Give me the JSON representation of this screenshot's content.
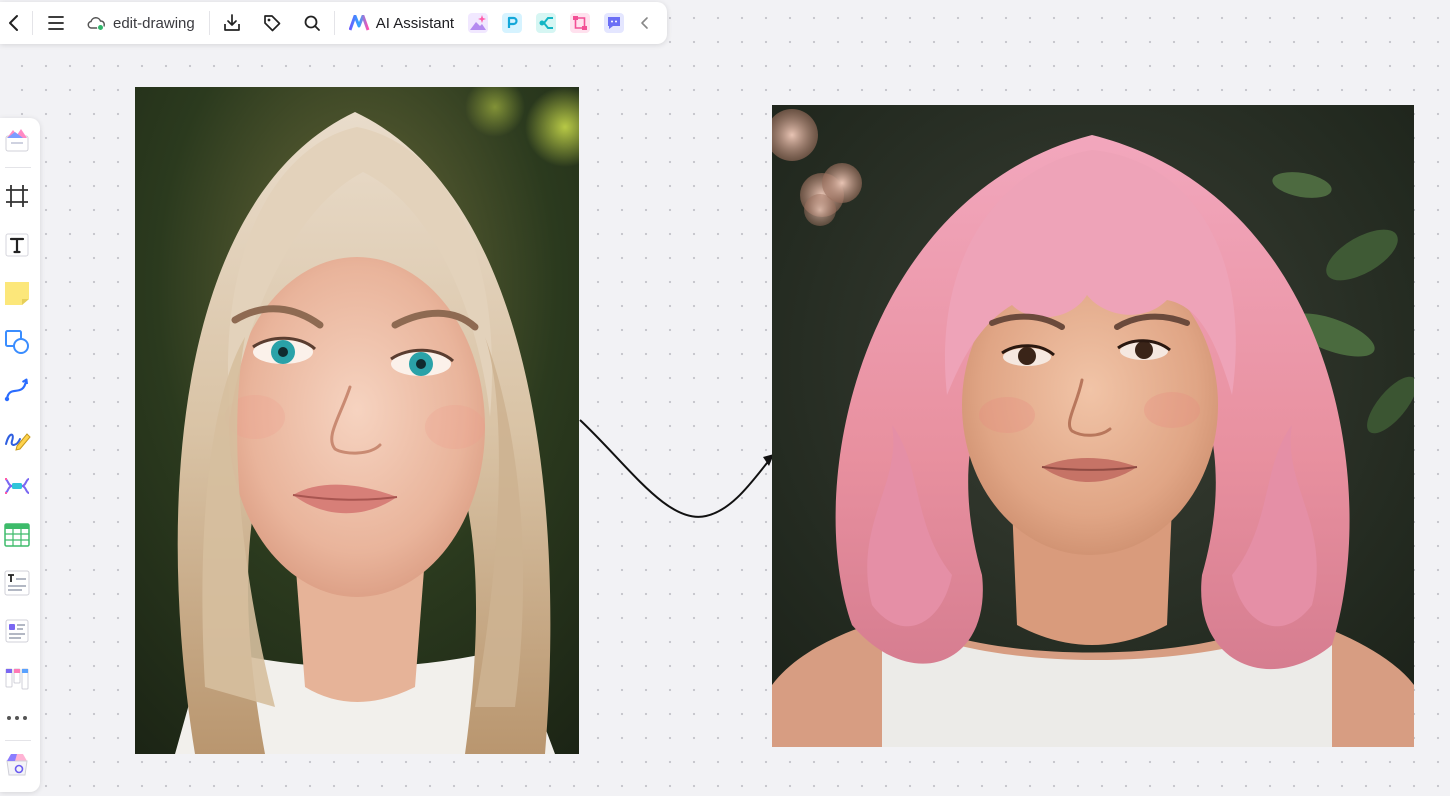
{
  "toolbar": {
    "doc_title": "edit-drawing",
    "ai_assistant_label": "AI Assistant",
    "icons": [
      "back-icon",
      "menu-icon",
      "cloud-sync-icon",
      "download-icon",
      "tag-icon",
      "search-icon",
      "ai-logo-icon",
      "image-generate-icon",
      "presentation-app-icon",
      "mindmap-app-icon",
      "flowchart-app-icon",
      "chat-app-icon",
      "collapse-chevron-icon"
    ]
  },
  "left_toolbar": {
    "tools": [
      "templates",
      "frame",
      "text",
      "sticky-note",
      "shapes",
      "connector-line",
      "pen",
      "mind-map",
      "table",
      "text-block",
      "list-card",
      "kanban",
      "more",
      "app-store"
    ]
  },
  "canvas": {
    "images": [
      "original-portrait",
      "edited-portrait"
    ],
    "connector": "curved-arrow"
  },
  "colors": {
    "canvas_bg": "#f2f2f5",
    "toolbar_bg": "#ffffff",
    "connector": "#111111"
  }
}
